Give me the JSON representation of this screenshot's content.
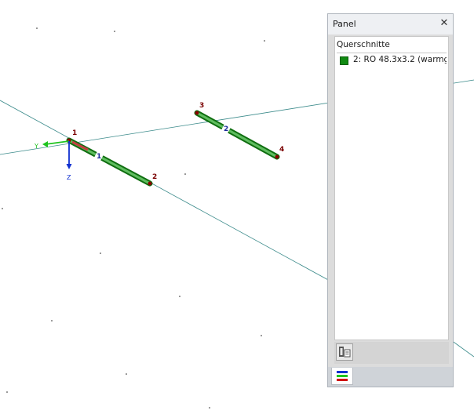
{
  "viewport": {
    "axis_y_label": "Y",
    "axis_z_label": "Z",
    "nodes": [
      {
        "label": "1"
      },
      {
        "label": "2"
      },
      {
        "label": "3"
      },
      {
        "label": "4"
      }
    ],
    "members": [
      {
        "label": "1"
      },
      {
        "label": "2"
      }
    ],
    "colors": {
      "member": "#118a12",
      "grid_line": "#3a8a8a",
      "axis_y": "#1fc41f",
      "axis_z": "#1030d0"
    }
  },
  "panel": {
    "title": "Panel",
    "close_icon": "close-icon",
    "section_header": "Querschnitte",
    "sections": [
      {
        "label": "2: RO 48.3x3.2 (warmge",
        "color": "#118a12"
      }
    ],
    "toolbar": {
      "settings_icon": "section-settings-icon"
    },
    "tabs": [
      {
        "icon": "color-legend-icon"
      }
    ]
  }
}
